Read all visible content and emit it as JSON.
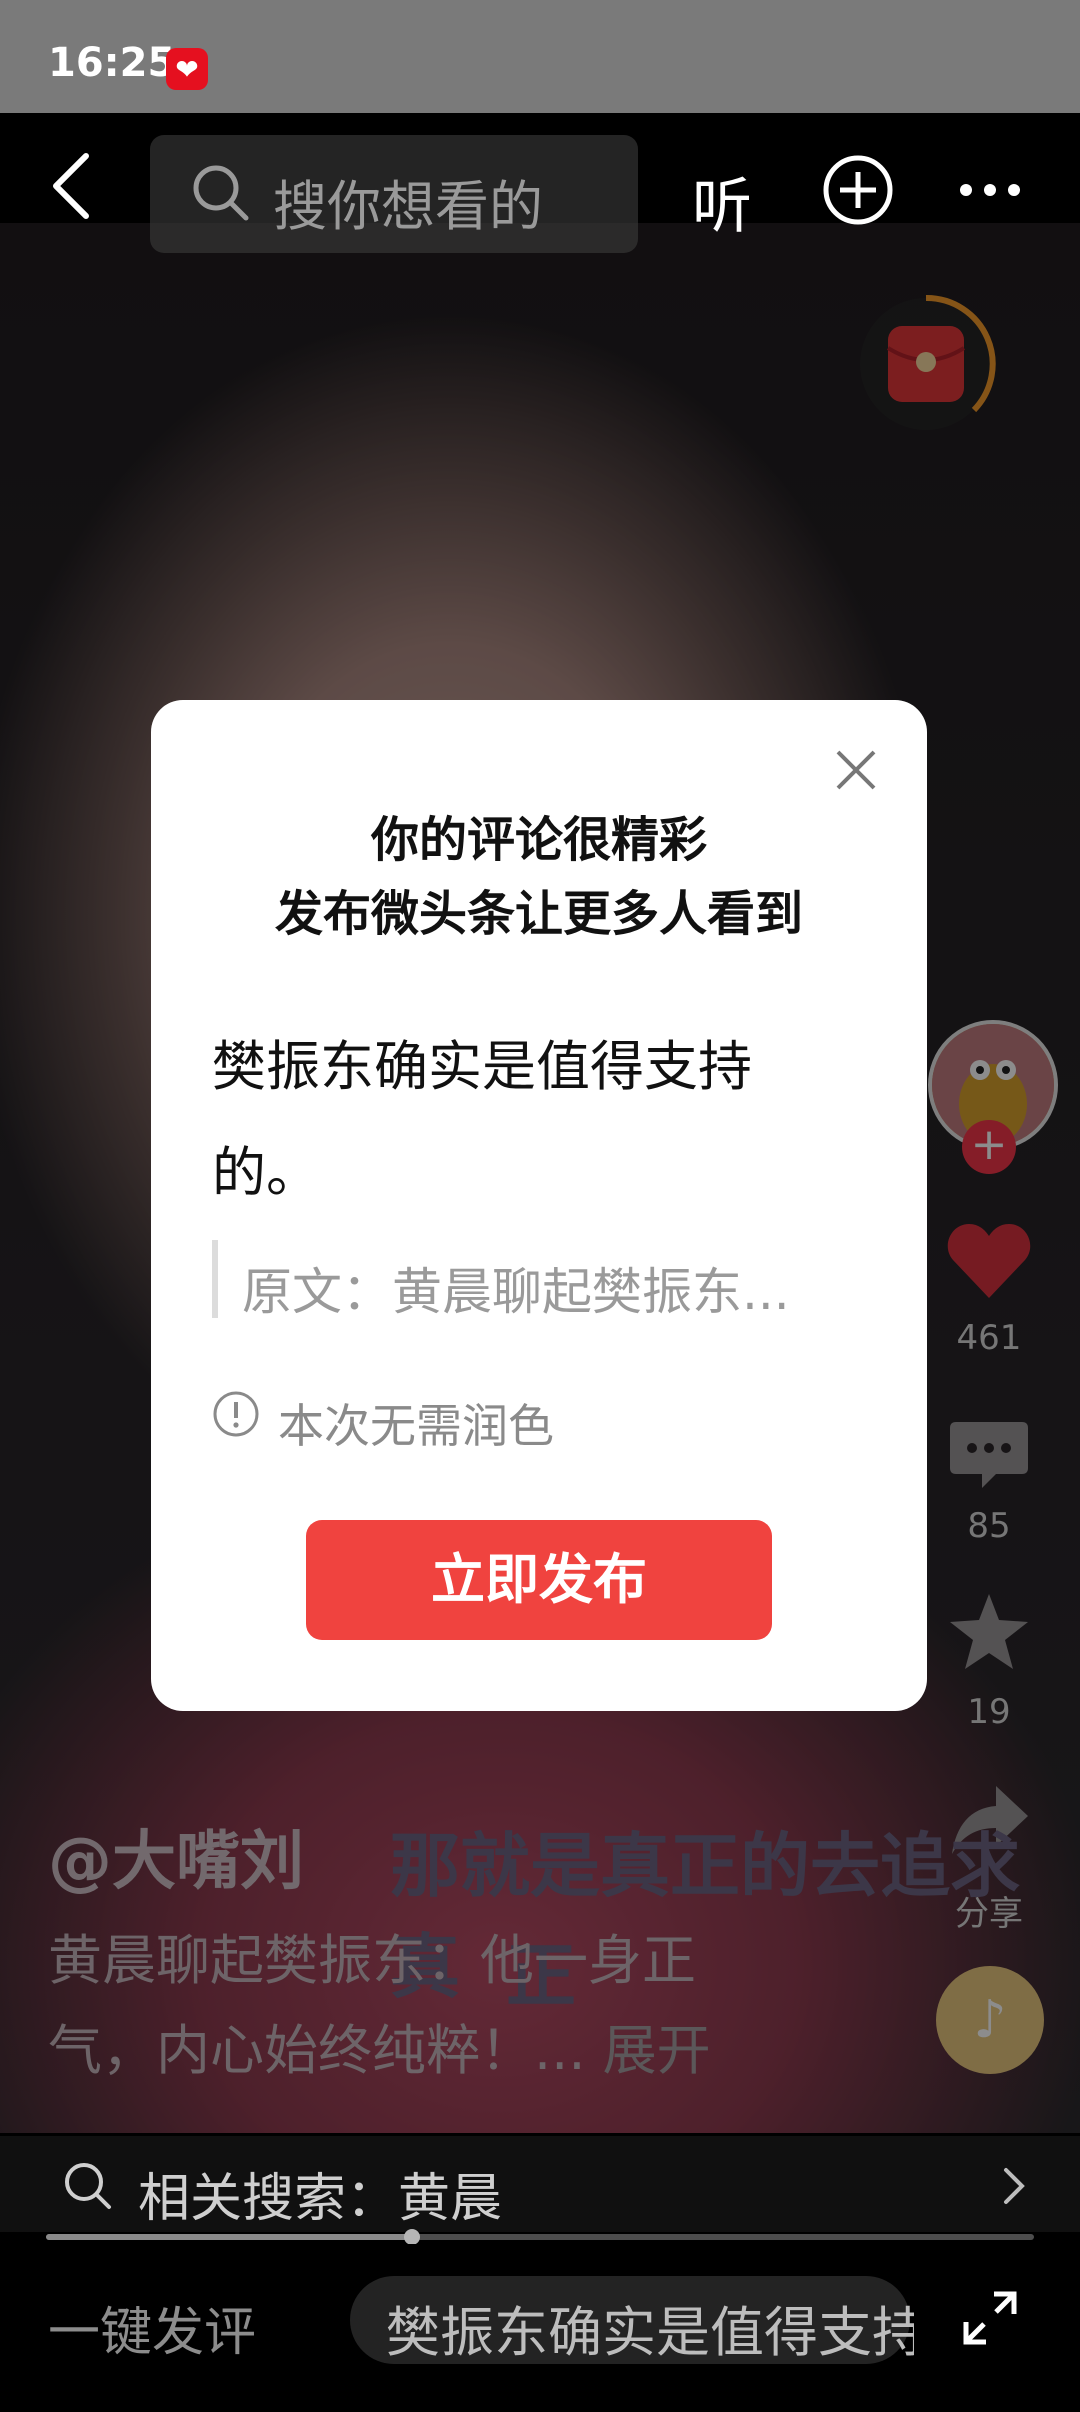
{
  "status_bar": {
    "time": "16:25",
    "app_icon": "red-heart-app-icon"
  },
  "top_bar": {
    "search_placeholder": "搜你想看的",
    "listen_label": "听",
    "icons": [
      "back-icon",
      "search-icon",
      "add-icon",
      "more-icon"
    ]
  },
  "right_rail": {
    "like_count": "461",
    "comment_count": "85",
    "favorite_count": "19",
    "share_label": "分享"
  },
  "video": {
    "author": "@大嘴刘",
    "subtitle_line1": "那就是真正的去追求真",
    "subtitle_line2": "正",
    "description": "黄晨聊起樊振东：他一身正气，内心始终纯粹！...",
    "expand_label": "展开"
  },
  "related_search": {
    "label": "相关搜索：黄晨",
    "progress": 0.37
  },
  "bottom_bar": {
    "one_click_label": "一键发评",
    "comment_preview": "樊振东确实是值得支持"
  },
  "modal": {
    "title_line1": "你的评论很精彩",
    "title_line2": "发布微头条让更多人看到",
    "comment_line1": "樊振东确实是值得支持",
    "comment_line2": "的。",
    "quote": "原文：黄晨聊起樊振东...",
    "info": "本次无需润色",
    "publish_button": "立即发布"
  },
  "colors": {
    "accent": "#f0433f",
    "like": "#f2364a"
  }
}
